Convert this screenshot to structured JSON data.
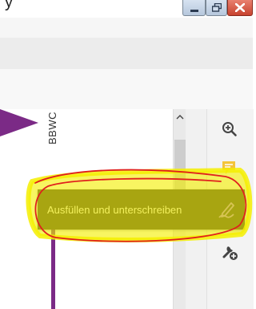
{
  "window": {
    "title_fragment": "y",
    "controls": {
      "minimize_icon": "minimize-icon",
      "maximize_icon": "restore-icon",
      "close_icon": "close-icon",
      "close_color": "#c7432f"
    }
  },
  "document": {
    "vertical_text": "BBWC",
    "accent_color": "#7b2a86"
  },
  "right_panel": {
    "tools": [
      {
        "icon": "zoom-in-icon"
      },
      {
        "icon": "comment-icon",
        "color": "#f3c43b"
      },
      {
        "icon": "fill-sign-pen-icon",
        "color": "#a97fd9"
      },
      {
        "icon": "tools-add-icon"
      }
    ]
  },
  "tooltip": {
    "label": "Ausfüllen und unterschreiben"
  },
  "annotation": {
    "highlight_color": "#f4ef00",
    "circle_color": "#e0201d"
  }
}
